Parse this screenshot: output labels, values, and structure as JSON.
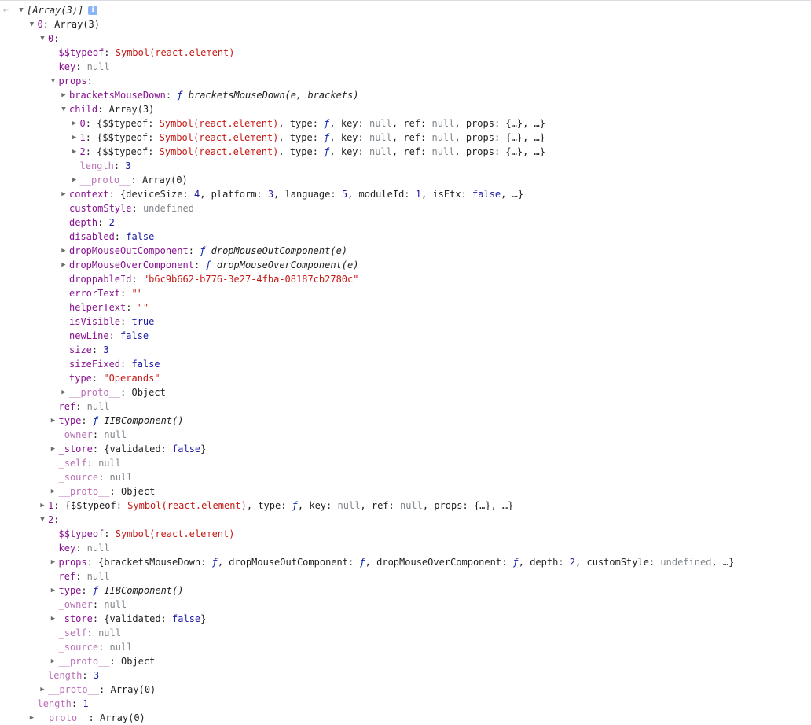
{
  "console": {
    "return_icon": "return-arrow-icon",
    "info_icon": "info-icon",
    "info_label": "i",
    "rows": [
      {
        "indent": 0,
        "arrow": "expanded",
        "t": [
          {
            "c": "fn",
            "v": "[Array(3)]"
          }
        ],
        "info": true
      },
      {
        "indent": 1,
        "arrow": "expanded",
        "t": [
          {
            "c": "k",
            "v": "0"
          },
          {
            "c": "p",
            "v": ": Array(3)"
          }
        ]
      },
      {
        "indent": 2,
        "arrow": "expanded",
        "t": [
          {
            "c": "k",
            "v": "0"
          },
          {
            "c": "p",
            "v": ":"
          }
        ]
      },
      {
        "indent": 3,
        "t": [
          {
            "c": "k",
            "v": "$$typeof"
          },
          {
            "c": "p",
            "v": ": "
          },
          {
            "c": "s",
            "v": "Symbol(react.element)"
          }
        ]
      },
      {
        "indent": 3,
        "t": [
          {
            "c": "k",
            "v": "key"
          },
          {
            "c": "p",
            "v": ": "
          },
          {
            "c": "g",
            "v": "null"
          }
        ]
      },
      {
        "indent": 3,
        "arrow": "expanded",
        "t": [
          {
            "c": "k",
            "v": "props"
          },
          {
            "c": "p",
            "v": ":"
          }
        ]
      },
      {
        "indent": 4,
        "arrow": "collapsed",
        "t": [
          {
            "c": "k",
            "v": "bracketsMouseDown"
          },
          {
            "c": "p",
            "v": ": "
          },
          {
            "c": "f",
            "v": "ƒ"
          },
          {
            "c": "fn",
            "v": " bracketsMouseDown(e, brackets)"
          }
        ]
      },
      {
        "indent": 4,
        "arrow": "expanded",
        "t": [
          {
            "c": "k",
            "v": "child"
          },
          {
            "c": "p",
            "v": ": Array(3)"
          }
        ]
      },
      {
        "indent": 5,
        "arrow": "collapsed",
        "t": [
          {
            "c": "k",
            "v": "0"
          },
          {
            "c": "p",
            "v": ": {$$typeof: "
          },
          {
            "c": "s",
            "v": "Symbol(react.element)"
          },
          {
            "c": "p",
            "v": ", type: "
          },
          {
            "c": "f",
            "v": "ƒ"
          },
          {
            "c": "p",
            "v": ", key: "
          },
          {
            "c": "g",
            "v": "null"
          },
          {
            "c": "p",
            "v": ", ref: "
          },
          {
            "c": "g",
            "v": "null"
          },
          {
            "c": "p",
            "v": ", props: {…}, …}"
          }
        ]
      },
      {
        "indent": 5,
        "arrow": "collapsed",
        "t": [
          {
            "c": "k",
            "v": "1"
          },
          {
            "c": "p",
            "v": ": {$$typeof: "
          },
          {
            "c": "s",
            "v": "Symbol(react.element)"
          },
          {
            "c": "p",
            "v": ", type: "
          },
          {
            "c": "f",
            "v": "ƒ"
          },
          {
            "c": "p",
            "v": ", key: "
          },
          {
            "c": "g",
            "v": "null"
          },
          {
            "c": "p",
            "v": ", ref: "
          },
          {
            "c": "g",
            "v": "null"
          },
          {
            "c": "p",
            "v": ", props: {…}, …}"
          }
        ]
      },
      {
        "indent": 5,
        "arrow": "collapsed",
        "t": [
          {
            "c": "k",
            "v": "2"
          },
          {
            "c": "p",
            "v": ": {$$typeof: "
          },
          {
            "c": "s",
            "v": "Symbol(react.element)"
          },
          {
            "c": "p",
            "v": ", type: "
          },
          {
            "c": "f",
            "v": "ƒ"
          },
          {
            "c": "p",
            "v": ", key: "
          },
          {
            "c": "g",
            "v": "null"
          },
          {
            "c": "p",
            "v": ", ref: "
          },
          {
            "c": "g",
            "v": "null"
          },
          {
            "c": "p",
            "v": ", props: {…}, …}"
          }
        ]
      },
      {
        "indent": 5,
        "t": [
          {
            "c": "kd",
            "v": "length"
          },
          {
            "c": "p",
            "v": ": "
          },
          {
            "c": "n",
            "v": "3"
          }
        ]
      },
      {
        "indent": 5,
        "arrow": "collapsed",
        "t": [
          {
            "c": "kd",
            "v": "__proto__"
          },
          {
            "c": "p",
            "v": ": Array(0)"
          }
        ]
      },
      {
        "indent": 4,
        "arrow": "collapsed",
        "t": [
          {
            "c": "k",
            "v": "context"
          },
          {
            "c": "p",
            "v": ": {deviceSize: "
          },
          {
            "c": "n",
            "v": "4"
          },
          {
            "c": "p",
            "v": ", platform: "
          },
          {
            "c": "n",
            "v": "3"
          },
          {
            "c": "p",
            "v": ", language: "
          },
          {
            "c": "n",
            "v": "5"
          },
          {
            "c": "p",
            "v": ", moduleId: "
          },
          {
            "c": "n",
            "v": "1"
          },
          {
            "c": "p",
            "v": ", isEtx: "
          },
          {
            "c": "n",
            "v": "false"
          },
          {
            "c": "p",
            "v": ", …}"
          }
        ]
      },
      {
        "indent": 4,
        "t": [
          {
            "c": "k",
            "v": "customStyle"
          },
          {
            "c": "p",
            "v": ": "
          },
          {
            "c": "g",
            "v": "undefined"
          }
        ]
      },
      {
        "indent": 4,
        "t": [
          {
            "c": "k",
            "v": "depth"
          },
          {
            "c": "p",
            "v": ": "
          },
          {
            "c": "n",
            "v": "2"
          }
        ]
      },
      {
        "indent": 4,
        "t": [
          {
            "c": "k",
            "v": "disabled"
          },
          {
            "c": "p",
            "v": ": "
          },
          {
            "c": "n",
            "v": "false"
          }
        ]
      },
      {
        "indent": 4,
        "arrow": "collapsed",
        "t": [
          {
            "c": "k",
            "v": "dropMouseOutComponent"
          },
          {
            "c": "p",
            "v": ": "
          },
          {
            "c": "f",
            "v": "ƒ"
          },
          {
            "c": "fn",
            "v": " dropMouseOutComponent(e)"
          }
        ]
      },
      {
        "indent": 4,
        "arrow": "collapsed",
        "t": [
          {
            "c": "k",
            "v": "dropMouseOverComponent"
          },
          {
            "c": "p",
            "v": ": "
          },
          {
            "c": "f",
            "v": "ƒ"
          },
          {
            "c": "fn",
            "v": " dropMouseOverComponent(e)"
          }
        ]
      },
      {
        "indent": 4,
        "t": [
          {
            "c": "k",
            "v": "droppableId"
          },
          {
            "c": "p",
            "v": ": "
          },
          {
            "c": "s",
            "v": "\"b6c9b662-b776-3e27-4fba-08187cb2780c\""
          }
        ]
      },
      {
        "indent": 4,
        "t": [
          {
            "c": "k",
            "v": "errorText"
          },
          {
            "c": "p",
            "v": ": "
          },
          {
            "c": "s",
            "v": "\"\""
          }
        ]
      },
      {
        "indent": 4,
        "t": [
          {
            "c": "k",
            "v": "helperText"
          },
          {
            "c": "p",
            "v": ": "
          },
          {
            "c": "s",
            "v": "\"\""
          }
        ]
      },
      {
        "indent": 4,
        "t": [
          {
            "c": "k",
            "v": "isVisible"
          },
          {
            "c": "p",
            "v": ": "
          },
          {
            "c": "n",
            "v": "true"
          }
        ]
      },
      {
        "indent": 4,
        "t": [
          {
            "c": "k",
            "v": "newLine"
          },
          {
            "c": "p",
            "v": ": "
          },
          {
            "c": "n",
            "v": "false"
          }
        ]
      },
      {
        "indent": 4,
        "t": [
          {
            "c": "k",
            "v": "size"
          },
          {
            "c": "p",
            "v": ": "
          },
          {
            "c": "n",
            "v": "3"
          }
        ]
      },
      {
        "indent": 4,
        "t": [
          {
            "c": "k",
            "v": "sizeFixed"
          },
          {
            "c": "p",
            "v": ": "
          },
          {
            "c": "n",
            "v": "false"
          }
        ]
      },
      {
        "indent": 4,
        "t": [
          {
            "c": "k",
            "v": "type"
          },
          {
            "c": "p",
            "v": ": "
          },
          {
            "c": "s",
            "v": "\"Operands\""
          }
        ]
      },
      {
        "indent": 4,
        "arrow": "collapsed",
        "t": [
          {
            "c": "kd",
            "v": "__proto__"
          },
          {
            "c": "p",
            "v": ": Object"
          }
        ]
      },
      {
        "indent": 3,
        "t": [
          {
            "c": "k",
            "v": "ref"
          },
          {
            "c": "p",
            "v": ": "
          },
          {
            "c": "g",
            "v": "null"
          }
        ]
      },
      {
        "indent": 3,
        "arrow": "collapsed",
        "t": [
          {
            "c": "k",
            "v": "type"
          },
          {
            "c": "p",
            "v": ": "
          },
          {
            "c": "f",
            "v": "ƒ"
          },
          {
            "c": "fn",
            "v": " IIBComponent()"
          }
        ]
      },
      {
        "indent": 3,
        "t": [
          {
            "c": "kd",
            "v": "_owner"
          },
          {
            "c": "p",
            "v": ": "
          },
          {
            "c": "g",
            "v": "null"
          }
        ]
      },
      {
        "indent": 3,
        "arrow": "collapsed",
        "t": [
          {
            "c": "k",
            "v": "_store"
          },
          {
            "c": "p",
            "v": ": {validated: "
          },
          {
            "c": "n",
            "v": "false"
          },
          {
            "c": "p",
            "v": "}"
          }
        ]
      },
      {
        "indent": 3,
        "t": [
          {
            "c": "kd",
            "v": "_self"
          },
          {
            "c": "p",
            "v": ": "
          },
          {
            "c": "g",
            "v": "null"
          }
        ]
      },
      {
        "indent": 3,
        "t": [
          {
            "c": "kd",
            "v": "_source"
          },
          {
            "c": "p",
            "v": ": "
          },
          {
            "c": "g",
            "v": "null"
          }
        ]
      },
      {
        "indent": 3,
        "arrow": "collapsed",
        "t": [
          {
            "c": "kd",
            "v": "__proto__"
          },
          {
            "c": "p",
            "v": ": Object"
          }
        ]
      },
      {
        "indent": 2,
        "arrow": "collapsed",
        "t": [
          {
            "c": "k",
            "v": "1"
          },
          {
            "c": "p",
            "v": ": {$$typeof: "
          },
          {
            "c": "s",
            "v": "Symbol(react.element)"
          },
          {
            "c": "p",
            "v": ", type: "
          },
          {
            "c": "f",
            "v": "ƒ"
          },
          {
            "c": "p",
            "v": ", key: "
          },
          {
            "c": "g",
            "v": "null"
          },
          {
            "c": "p",
            "v": ", ref: "
          },
          {
            "c": "g",
            "v": "null"
          },
          {
            "c": "p",
            "v": ", props: {…}, …}"
          }
        ]
      },
      {
        "indent": 2,
        "arrow": "expanded",
        "t": [
          {
            "c": "k",
            "v": "2"
          },
          {
            "c": "p",
            "v": ":"
          }
        ]
      },
      {
        "indent": 3,
        "t": [
          {
            "c": "k",
            "v": "$$typeof"
          },
          {
            "c": "p",
            "v": ": "
          },
          {
            "c": "s",
            "v": "Symbol(react.element)"
          }
        ]
      },
      {
        "indent": 3,
        "t": [
          {
            "c": "k",
            "v": "key"
          },
          {
            "c": "p",
            "v": ": "
          },
          {
            "c": "g",
            "v": "null"
          }
        ]
      },
      {
        "indent": 3,
        "arrow": "collapsed",
        "t": [
          {
            "c": "k",
            "v": "props"
          },
          {
            "c": "p",
            "v": ": {bracketsMouseDown: "
          },
          {
            "c": "f",
            "v": "ƒ"
          },
          {
            "c": "p",
            "v": ", dropMouseOutComponent: "
          },
          {
            "c": "f",
            "v": "ƒ"
          },
          {
            "c": "p",
            "v": ", dropMouseOverComponent: "
          },
          {
            "c": "f",
            "v": "ƒ"
          },
          {
            "c": "p",
            "v": ", depth: "
          },
          {
            "c": "n",
            "v": "2"
          },
          {
            "c": "p",
            "v": ", customStyle: "
          },
          {
            "c": "g",
            "v": "undefined"
          },
          {
            "c": "p",
            "v": ", …}"
          }
        ]
      },
      {
        "indent": 3,
        "t": [
          {
            "c": "k",
            "v": "ref"
          },
          {
            "c": "p",
            "v": ": "
          },
          {
            "c": "g",
            "v": "null"
          }
        ]
      },
      {
        "indent": 3,
        "arrow": "collapsed",
        "t": [
          {
            "c": "k",
            "v": "type"
          },
          {
            "c": "p",
            "v": ": "
          },
          {
            "c": "f",
            "v": "ƒ"
          },
          {
            "c": "fn",
            "v": " IIBComponent()"
          }
        ]
      },
      {
        "indent": 3,
        "t": [
          {
            "c": "kd",
            "v": "_owner"
          },
          {
            "c": "p",
            "v": ": "
          },
          {
            "c": "g",
            "v": "null"
          }
        ]
      },
      {
        "indent": 3,
        "arrow": "collapsed",
        "t": [
          {
            "c": "k",
            "v": "_store"
          },
          {
            "c": "p",
            "v": ": {validated: "
          },
          {
            "c": "n",
            "v": "false"
          },
          {
            "c": "p",
            "v": "}"
          }
        ]
      },
      {
        "indent": 3,
        "t": [
          {
            "c": "kd",
            "v": "_self"
          },
          {
            "c": "p",
            "v": ": "
          },
          {
            "c": "g",
            "v": "null"
          }
        ]
      },
      {
        "indent": 3,
        "t": [
          {
            "c": "kd",
            "v": "_source"
          },
          {
            "c": "p",
            "v": ": "
          },
          {
            "c": "g",
            "v": "null"
          }
        ]
      },
      {
        "indent": 3,
        "arrow": "collapsed",
        "t": [
          {
            "c": "kd",
            "v": "__proto__"
          },
          {
            "c": "p",
            "v": ": Object"
          }
        ]
      },
      {
        "indent": 2,
        "t": [
          {
            "c": "kd",
            "v": "length"
          },
          {
            "c": "p",
            "v": ": "
          },
          {
            "c": "n",
            "v": "3"
          }
        ]
      },
      {
        "indent": 2,
        "arrow": "collapsed",
        "t": [
          {
            "c": "kd",
            "v": "__proto__"
          },
          {
            "c": "p",
            "v": ": Array(0)"
          }
        ]
      },
      {
        "indent": 1,
        "t": [
          {
            "c": "kd",
            "v": "length"
          },
          {
            "c": "p",
            "v": ": "
          },
          {
            "c": "n",
            "v": "1"
          }
        ]
      },
      {
        "indent": 1,
        "arrow": "collapsed",
        "t": [
          {
            "c": "kd",
            "v": "__proto__"
          },
          {
            "c": "p",
            "v": ": Array(0)"
          }
        ]
      }
    ]
  }
}
